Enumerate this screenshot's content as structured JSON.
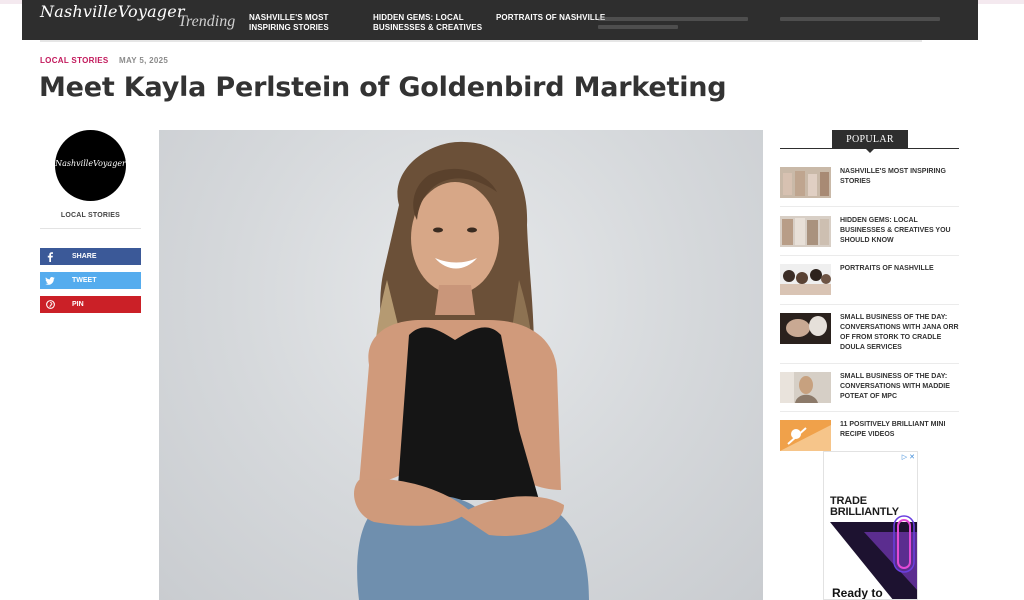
{
  "header": {
    "logo": "NashvilleVoyager",
    "trending_label": "Trending",
    "nav": [
      {
        "label": "NASHVILLE'S MOST INSPIRING STORIES"
      },
      {
        "label": "HIDDEN GEMS: LOCAL BUSINESSES & CREATIVES"
      },
      {
        "label": "PORTRAITS OF NASHVILLE"
      }
    ]
  },
  "article": {
    "category": "LOCAL STORIES",
    "date": "MAY 5, 2025",
    "title": "Meet Kayla Perlstein of Goldenbird Marketing"
  },
  "author": {
    "avatar_text": "NashvilleVoyager",
    "label": "LOCAL STORIES"
  },
  "share": {
    "facebook": "SHARE",
    "twitter": "TWEET",
    "pinterest": "PIN"
  },
  "popular": {
    "heading": "POPULAR",
    "items": [
      {
        "title": "NASHVILLE'S MOST INSPIRING STORIES"
      },
      {
        "title": "HIDDEN GEMS: LOCAL BUSINESSES & CREATIVES YOU SHOULD KNOW"
      },
      {
        "title": "PORTRAITS OF NASHVILLE"
      },
      {
        "title": "SMALL BUSINESS OF THE DAY: CONVERSATIONS WITH JANA ORR OF FROM STORK TO CRADLE DOULA SERVICES"
      },
      {
        "title": "SMALL BUSINESS OF THE DAY: CONVERSATIONS WITH MADDIE POTEAT OF MPC"
      },
      {
        "title": "11 POSITIVELY BRILLIANT MINI RECIPE VIDEOS"
      }
    ]
  },
  "ad": {
    "headline": "TRADE BRILLIANTLY",
    "footer": "Ready to"
  },
  "colors": {
    "topbar": "#2e2e2e",
    "category": "#c2185b",
    "facebook": "#3b5998",
    "twitter": "#55acee",
    "pinterest": "#cb2027"
  }
}
